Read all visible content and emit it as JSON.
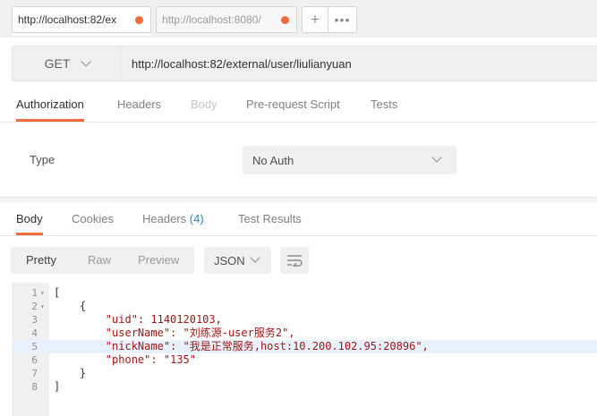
{
  "tabs": [
    {
      "label": "http://localhost:82/ex"
    },
    {
      "label": "http://localhost:8080/"
    }
  ],
  "toolbar": {
    "new_tab_glyph": "+",
    "more_glyph": "•••"
  },
  "request": {
    "method": "GET",
    "url": "http://localhost:82/external/user/liulianyuan"
  },
  "request_tabs": [
    {
      "label": "Authorization",
      "state": "active"
    },
    {
      "label": "Headers",
      "state": "normal"
    },
    {
      "label": "Body",
      "state": "disabled"
    },
    {
      "label": "Pre-request Script",
      "state": "normal"
    },
    {
      "label": "Tests",
      "state": "normal"
    }
  ],
  "auth": {
    "type_label": "Type",
    "selected": "No Auth"
  },
  "response_tabs": [
    {
      "label": "Body",
      "state": "active"
    },
    {
      "label": "Cookies",
      "state": "normal"
    },
    {
      "label": "Headers",
      "count": "(4)",
      "state": "normal"
    },
    {
      "label": "Test Results",
      "state": "normal"
    }
  ],
  "view_modes": [
    {
      "label": "Pretty",
      "state": "active"
    },
    {
      "label": "Raw",
      "state": "normal"
    },
    {
      "label": "Preview",
      "state": "normal"
    }
  ],
  "format": {
    "selected": "JSON"
  },
  "code_lines": [
    {
      "num": "1",
      "text": "[",
      "fold": "▾"
    },
    {
      "num": "2",
      "text": "    {",
      "fold": "▾"
    },
    {
      "num": "3",
      "text": "        \"uid\": 1140120103,"
    },
    {
      "num": "4",
      "text": "        \"userName\": \"刘练源-user服务2\","
    },
    {
      "num": "5",
      "text": "        \"nickName\": \"我是正常服务,host:10.200.102.95:20896\",",
      "highlight": true
    },
    {
      "num": "6",
      "text": "        \"phone\": \"135\""
    },
    {
      "num": "7",
      "text": "    }"
    },
    {
      "num": "8",
      "text": "]"
    }
  ],
  "colors": {
    "accent": "#f26b3a",
    "link": "#2f80c5",
    "json_key": "#a31515",
    "json_number": "#1a1aa6"
  }
}
